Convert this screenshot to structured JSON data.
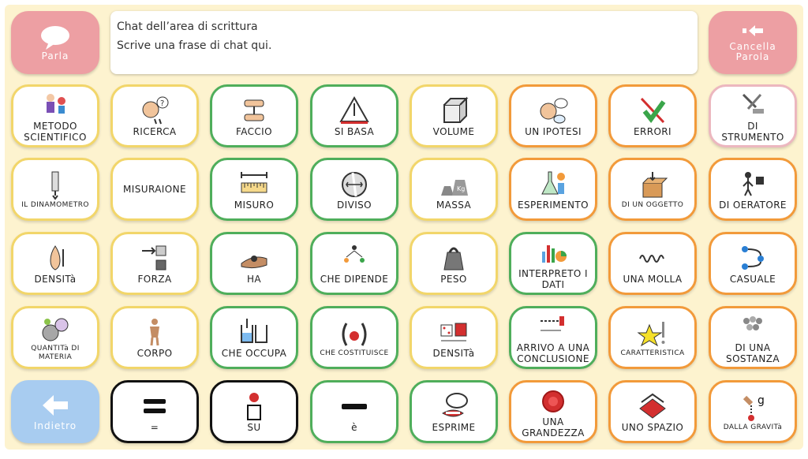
{
  "speak_button": {
    "label": "Parla",
    "icon": "speech-bubble-icon"
  },
  "clear_button": {
    "label": "Cancella Parola",
    "icon": "backspace-arrow-icon"
  },
  "back_button": {
    "label": "Indietro",
    "icon": "arrow-left-icon"
  },
  "chat": {
    "line1": "Chat dell’area di scrittura",
    "line2": "Scrive una frase di chat qui."
  },
  "tiles": [
    {
      "label": "METODO SCIENTIFICO",
      "border": "yellow",
      "icon": "scientist-icon"
    },
    {
      "label": "RICERCA",
      "border": "yellow",
      "icon": "thinking-head-icon"
    },
    {
      "label": "FACCIO",
      "border": "green",
      "icon": "hands-doing-icon"
    },
    {
      "label": "SI BASA",
      "border": "green",
      "icon": "triangle-base-icon"
    },
    {
      "label": "VOLUME",
      "border": "yellow",
      "icon": "cube-volume-icon"
    },
    {
      "label": "UN IPOTESI",
      "border": "orange",
      "icon": "hypothesis-head-icon"
    },
    {
      "label": "ERRORI",
      "border": "orange",
      "icon": "check-cross-icon"
    },
    {
      "label": "DI STRUMENTO",
      "border": "pink",
      "icon": "tools-icon"
    },
    {
      "label": "IL DINAMOMETRO",
      "border": "yellow",
      "icon": "dynamometer-icon",
      "small": true
    },
    {
      "label": "MISURAIONE",
      "border": "yellow",
      "icon": ""
    },
    {
      "label": "MISURO",
      "border": "green",
      "icon": "ruler-icon"
    },
    {
      "label": "DIVISO",
      "border": "green",
      "icon": "divided-circle-icon"
    },
    {
      "label": "MASSA",
      "border": "yellow",
      "icon": "weights-icon"
    },
    {
      "label": "ESPERIMENTO",
      "border": "orange",
      "icon": "experiment-flask-icon"
    },
    {
      "label": "DI UN OGGETTO",
      "border": "orange",
      "icon": "box-object-icon",
      "small": true
    },
    {
      "label": "DI OERATORE",
      "border": "orange",
      "icon": "operator-icon"
    },
    {
      "label": "DENSITà",
      "border": "yellow",
      "icon": "density-drop-icon"
    },
    {
      "label": "FORZA",
      "border": "yellow",
      "icon": "force-push-icon"
    },
    {
      "label": "HA",
      "border": "green",
      "icon": "hand-holding-icon"
    },
    {
      "label": "CHE DIPENDE",
      "border": "green",
      "icon": "depend-people-icon"
    },
    {
      "label": "PESO",
      "border": "yellow",
      "icon": "weight-icon"
    },
    {
      "label": "INTERPRETO I DATI",
      "border": "green",
      "icon": "data-chart-icon"
    },
    {
      "label": "UNA MOLLA",
      "border": "orange",
      "icon": "spring-icon"
    },
    {
      "label": "CASUALE",
      "border": "orange",
      "icon": "random-arrows-icon"
    },
    {
      "label": "QUANTITà DI MATERIA",
      "border": "yellow",
      "icon": "matter-balls-icon",
      "small": true
    },
    {
      "label": "CORPO",
      "border": "yellow",
      "icon": "body-icon"
    },
    {
      "label": "CHE OCCUPA",
      "border": "green",
      "icon": "occupy-beaker-icon"
    },
    {
      "label": "CHE COSTITUISCE",
      "border": "green",
      "icon": "constitute-icon",
      "small": true
    },
    {
      "label": "DENSITà",
      "border": "yellow",
      "icon": "density-cubes-icon"
    },
    {
      "label": "ARRIVO A UNA CONCLUSIONE",
      "border": "green",
      "icon": "conclusion-arrow-icon"
    },
    {
      "label": "CARATTERISTICA",
      "border": "orange",
      "icon": "star-feature-icon",
      "small": true
    },
    {
      "label": "DI UNA SOSTANZA",
      "border": "orange",
      "icon": "substance-icon"
    },
    {
      "label": "=",
      "border": "black",
      "icon": "equals-icon"
    },
    {
      "label": "SU",
      "border": "black",
      "icon": "on-top-icon"
    },
    {
      "label": "è",
      "border": "green",
      "icon": "minus-icon"
    },
    {
      "label": "ESPRIME",
      "border": "green",
      "icon": "express-mouth-icon"
    },
    {
      "label": "UNA GRANDEZZA",
      "border": "orange",
      "icon": "red-circle-icon"
    },
    {
      "label": "UNO SPAZIO",
      "border": "orange",
      "icon": "red-space-icon"
    },
    {
      "label": "DALLA GRAVITà",
      "border": "orange",
      "icon": "gravity-hand-icon",
      "small": true
    }
  ],
  "colors": {
    "background": "#fdf3cf",
    "pink_button": "#ed9fa3",
    "blue_button": "#a8ccf0",
    "yellow_border": "#f2d66a",
    "green_border": "#4fae5b",
    "orange_border": "#f29a3a",
    "pink_border": "#ecb7bf",
    "black_border": "#111111"
  }
}
